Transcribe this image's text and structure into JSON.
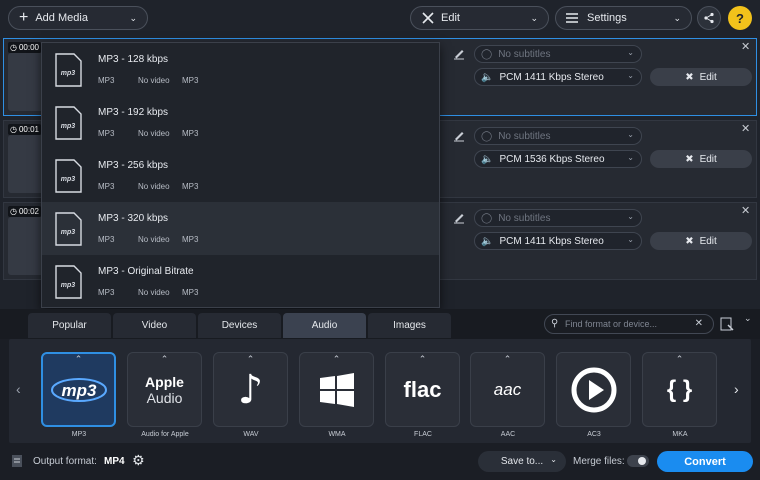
{
  "toolbar": {
    "add_media": "Add Media",
    "edit": "Edit",
    "settings": "Settings",
    "help": "?"
  },
  "files": [
    {
      "duration": "00:00",
      "subtitles": "No subtitles",
      "audio": "PCM 1411 Kbps Stereo",
      "edit": "Edit"
    },
    {
      "duration": "00:01",
      "subtitles": "No subtitles",
      "audio": "PCM 1536 Kbps Stereo",
      "edit": "Edit"
    },
    {
      "duration": "00:02",
      "subtitles": "No subtitles",
      "audio": "PCM 1411 Kbps Stereo",
      "edit": "Edit"
    }
  ],
  "presets": [
    {
      "title": "MP3 - 128 kbps",
      "format": "MP3",
      "video": "No video",
      "audio": "MP3"
    },
    {
      "title": "MP3 - 192 kbps",
      "format": "MP3",
      "video": "No video",
      "audio": "MP3"
    },
    {
      "title": "MP3 - 256 kbps",
      "format": "MP3",
      "video": "No video",
      "audio": "MP3"
    },
    {
      "title": "MP3 - 320 kbps",
      "format": "MP3",
      "video": "No video",
      "audio": "MP3"
    },
    {
      "title": "MP3 - Original Bitrate",
      "format": "MP3",
      "video": "No video",
      "audio": "MP3"
    }
  ],
  "tabs": [
    "Popular",
    "Video",
    "Devices",
    "Audio",
    "Images"
  ],
  "active_tab": "Audio",
  "search": {
    "placeholder": "Find format or device..."
  },
  "formats": [
    {
      "label": "MP3",
      "icon_text": "mp3"
    },
    {
      "label": "Audio for Apple",
      "icon_text": "Apple",
      "icon_text2": "Audio"
    },
    {
      "label": "WAV",
      "icon_text": "♪"
    },
    {
      "label": "WMA",
      "icon_text": ""
    },
    {
      "label": "FLAC",
      "icon_text": "flac"
    },
    {
      "label": "AAC",
      "icon_text": "aac"
    },
    {
      "label": "AC3",
      "icon_text": ""
    },
    {
      "label": "MKA",
      "icon_text": "{ }"
    }
  ],
  "footer": {
    "output_format_label": "Output format:",
    "output_format_value": "MP4",
    "save_to": "Save to...",
    "merge_files": "Merge files:",
    "convert": "Convert"
  },
  "colors": {
    "accent": "#1a8cf0",
    "selected_border": "#2f8fe3",
    "background": "#1f232b"
  }
}
